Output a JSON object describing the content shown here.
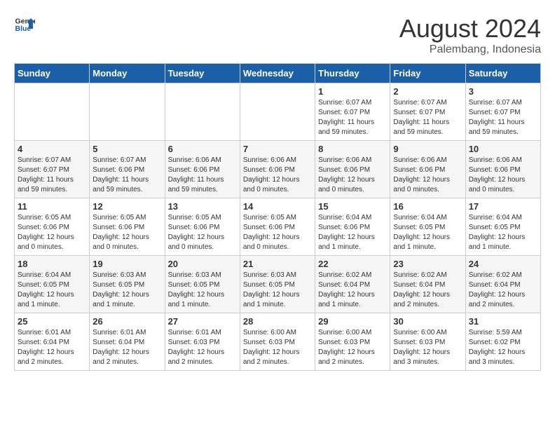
{
  "header": {
    "logo_line1": "General",
    "logo_line2": "Blue",
    "month_title": "August 2024",
    "subtitle": "Palembang, Indonesia"
  },
  "days_of_week": [
    "Sunday",
    "Monday",
    "Tuesday",
    "Wednesday",
    "Thursday",
    "Friday",
    "Saturday"
  ],
  "weeks": [
    [
      {
        "day": "",
        "info": ""
      },
      {
        "day": "",
        "info": ""
      },
      {
        "day": "",
        "info": ""
      },
      {
        "day": "",
        "info": ""
      },
      {
        "day": "1",
        "info": "Sunrise: 6:07 AM\nSunset: 6:07 PM\nDaylight: 11 hours\nand 59 minutes."
      },
      {
        "day": "2",
        "info": "Sunrise: 6:07 AM\nSunset: 6:07 PM\nDaylight: 11 hours\nand 59 minutes."
      },
      {
        "day": "3",
        "info": "Sunrise: 6:07 AM\nSunset: 6:07 PM\nDaylight: 11 hours\nand 59 minutes."
      }
    ],
    [
      {
        "day": "4",
        "info": "Sunrise: 6:07 AM\nSunset: 6:07 PM\nDaylight: 11 hours\nand 59 minutes."
      },
      {
        "day": "5",
        "info": "Sunrise: 6:07 AM\nSunset: 6:06 PM\nDaylight: 11 hours\nand 59 minutes."
      },
      {
        "day": "6",
        "info": "Sunrise: 6:06 AM\nSunset: 6:06 PM\nDaylight: 11 hours\nand 59 minutes."
      },
      {
        "day": "7",
        "info": "Sunrise: 6:06 AM\nSunset: 6:06 PM\nDaylight: 12 hours\nand 0 minutes."
      },
      {
        "day": "8",
        "info": "Sunrise: 6:06 AM\nSunset: 6:06 PM\nDaylight: 12 hours\nand 0 minutes."
      },
      {
        "day": "9",
        "info": "Sunrise: 6:06 AM\nSunset: 6:06 PM\nDaylight: 12 hours\nand 0 minutes."
      },
      {
        "day": "10",
        "info": "Sunrise: 6:06 AM\nSunset: 6:06 PM\nDaylight: 12 hours\nand 0 minutes."
      }
    ],
    [
      {
        "day": "11",
        "info": "Sunrise: 6:05 AM\nSunset: 6:06 PM\nDaylight: 12 hours\nand 0 minutes."
      },
      {
        "day": "12",
        "info": "Sunrise: 6:05 AM\nSunset: 6:06 PM\nDaylight: 12 hours\nand 0 minutes."
      },
      {
        "day": "13",
        "info": "Sunrise: 6:05 AM\nSunset: 6:06 PM\nDaylight: 12 hours\nand 0 minutes."
      },
      {
        "day": "14",
        "info": "Sunrise: 6:05 AM\nSunset: 6:06 PM\nDaylight: 12 hours\nand 0 minutes."
      },
      {
        "day": "15",
        "info": "Sunrise: 6:04 AM\nSunset: 6:06 PM\nDaylight: 12 hours\nand 1 minute."
      },
      {
        "day": "16",
        "info": "Sunrise: 6:04 AM\nSunset: 6:05 PM\nDaylight: 12 hours\nand 1 minute."
      },
      {
        "day": "17",
        "info": "Sunrise: 6:04 AM\nSunset: 6:05 PM\nDaylight: 12 hours\nand 1 minute."
      }
    ],
    [
      {
        "day": "18",
        "info": "Sunrise: 6:04 AM\nSunset: 6:05 PM\nDaylight: 12 hours\nand 1 minute."
      },
      {
        "day": "19",
        "info": "Sunrise: 6:03 AM\nSunset: 6:05 PM\nDaylight: 12 hours\nand 1 minute."
      },
      {
        "day": "20",
        "info": "Sunrise: 6:03 AM\nSunset: 6:05 PM\nDaylight: 12 hours\nand 1 minute."
      },
      {
        "day": "21",
        "info": "Sunrise: 6:03 AM\nSunset: 6:05 PM\nDaylight: 12 hours\nand 1 minute."
      },
      {
        "day": "22",
        "info": "Sunrise: 6:02 AM\nSunset: 6:04 PM\nDaylight: 12 hours\nand 1 minute."
      },
      {
        "day": "23",
        "info": "Sunrise: 6:02 AM\nSunset: 6:04 PM\nDaylight: 12 hours\nand 2 minutes."
      },
      {
        "day": "24",
        "info": "Sunrise: 6:02 AM\nSunset: 6:04 PM\nDaylight: 12 hours\nand 2 minutes."
      }
    ],
    [
      {
        "day": "25",
        "info": "Sunrise: 6:01 AM\nSunset: 6:04 PM\nDaylight: 12 hours\nand 2 minutes."
      },
      {
        "day": "26",
        "info": "Sunrise: 6:01 AM\nSunset: 6:04 PM\nDaylight: 12 hours\nand 2 minutes."
      },
      {
        "day": "27",
        "info": "Sunrise: 6:01 AM\nSunset: 6:03 PM\nDaylight: 12 hours\nand 2 minutes."
      },
      {
        "day": "28",
        "info": "Sunrise: 6:00 AM\nSunset: 6:03 PM\nDaylight: 12 hours\nand 2 minutes."
      },
      {
        "day": "29",
        "info": "Sunrise: 6:00 AM\nSunset: 6:03 PM\nDaylight: 12 hours\nand 2 minutes."
      },
      {
        "day": "30",
        "info": "Sunrise: 6:00 AM\nSunset: 6:03 PM\nDaylight: 12 hours\nand 3 minutes."
      },
      {
        "day": "31",
        "info": "Sunrise: 5:59 AM\nSunset: 6:02 PM\nDaylight: 12 hours\nand 3 minutes."
      }
    ]
  ]
}
